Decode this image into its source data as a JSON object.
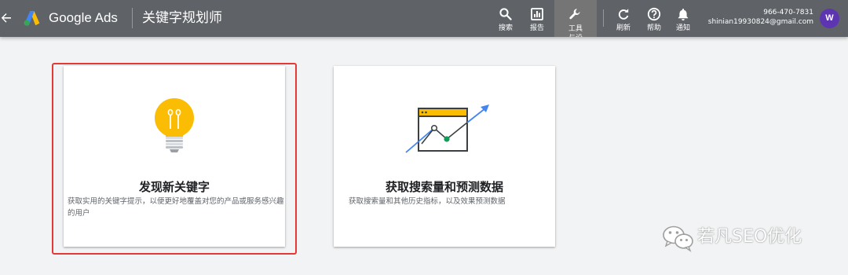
{
  "header": {
    "brand": "Google Ads",
    "page_title": "关键字规划师",
    "nav": [
      {
        "label": "搜索",
        "icon": "search-icon"
      },
      {
        "label": "报告",
        "icon": "reports-icon"
      },
      {
        "label": "工具与设置",
        "icon": "wrench-icon"
      },
      {
        "label": "刷新",
        "icon": "refresh-icon"
      },
      {
        "label": "帮助",
        "icon": "help-icon"
      },
      {
        "label": "通知",
        "icon": "bell-icon"
      }
    ],
    "account": {
      "phone": "966-470-7831",
      "email": "shinian19930824@gmail.com",
      "avatar_letter": "W"
    }
  },
  "cards": [
    {
      "title": "发现新关键字",
      "description": "获取实用的关键字提示，以便更好地覆盖对您的产品或服务感兴趣的用户",
      "icon": "lightbulb-icon"
    },
    {
      "title": "获取搜索量和预测数据",
      "description": "获取搜索量和其他历史指标，以及效果预测数据",
      "icon": "forecast-chart-icon"
    }
  ],
  "watermark": {
    "text": "若凡SEO优化",
    "icon": "wechat-icon"
  },
  "colors": {
    "topbar": "#5f6368",
    "highlight": "#e53935",
    "avatar": "#5e35b1",
    "bulb": "#fbbc04"
  }
}
